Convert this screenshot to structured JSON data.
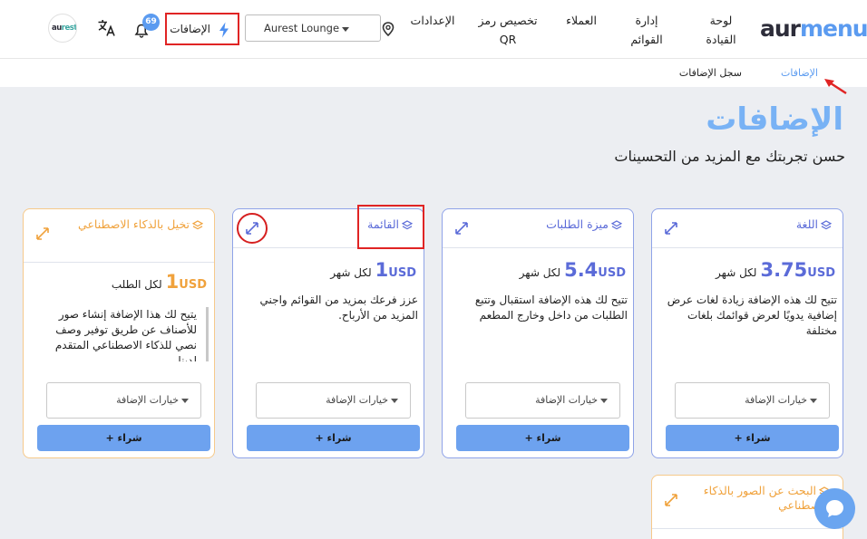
{
  "header": {
    "logo": {
      "part1": "aur",
      "part2": "menu"
    },
    "nav": {
      "dashboard": "لوحة القيادة",
      "menus": "إدارة القوائم",
      "customers": "العملاء",
      "qr": "تخصيص رمز QR",
      "settings": "الإعدادات"
    },
    "location": "Aurest Lounge",
    "addons_button": "الإضافات",
    "notifications_count": "69",
    "avatar_text": {
      "part1": "au",
      "part2": "rest"
    }
  },
  "subnav": {
    "active_tab": "الإضافات",
    "other_tab": "سجل الإضافات"
  },
  "page": {
    "title": "الإضافات",
    "subtitle": "حسن تجربتك مع المزيد من التحسينات"
  },
  "cards": [
    {
      "name": "اللغة",
      "amount": "3.75",
      "currency": "USD",
      "period": "لكل شهر",
      "description": "تتيح لك هذه الإضافة زيادة لغات عرض إضافية يدويًا لعرض قوائمك بلغات مختلفة",
      "options_label": "خيارات الإضافة",
      "buy_label": "شراء +"
    },
    {
      "name": "ميزة الطلبات",
      "amount": "5.4",
      "currency": "USD",
      "period": "لكل شهر",
      "description": "تتيح لك هذه الإضافة استقبال وتتبع الطلبات من داخل وخارج المطعم",
      "options_label": "خيارات الإضافة",
      "buy_label": "شراء +"
    },
    {
      "name": "القائمة",
      "amount": "1",
      "currency": "USD",
      "period": "لكل شهر",
      "description": "عزز فرعك بمزيد من القوائم واجني المزيد من الأرباح.",
      "options_label": "خيارات الإضافة",
      "buy_label": "شراء +"
    },
    {
      "name": "تخيل بالذكاء الاصطناعي",
      "amount": "1",
      "currency": "USD",
      "period": "لكل الطلب",
      "description": "يتيح لك هذا الإضافة إنشاء صور للأصناف عن طريق توفير وصف نصي للذكاء الاصطناعي المتقدم لدينا",
      "options_label": "خيارات الإضافة",
      "buy_label": "شراء +"
    }
  ],
  "partial_card": {
    "name": "البحث عن الصور بالذكاء الاصطناعي"
  },
  "colors": {
    "accent_blue": "#5b6bd8",
    "accent_orange": "#f0a23c",
    "title_blue": "#78b2f5",
    "button_blue": "#6da2ef"
  }
}
